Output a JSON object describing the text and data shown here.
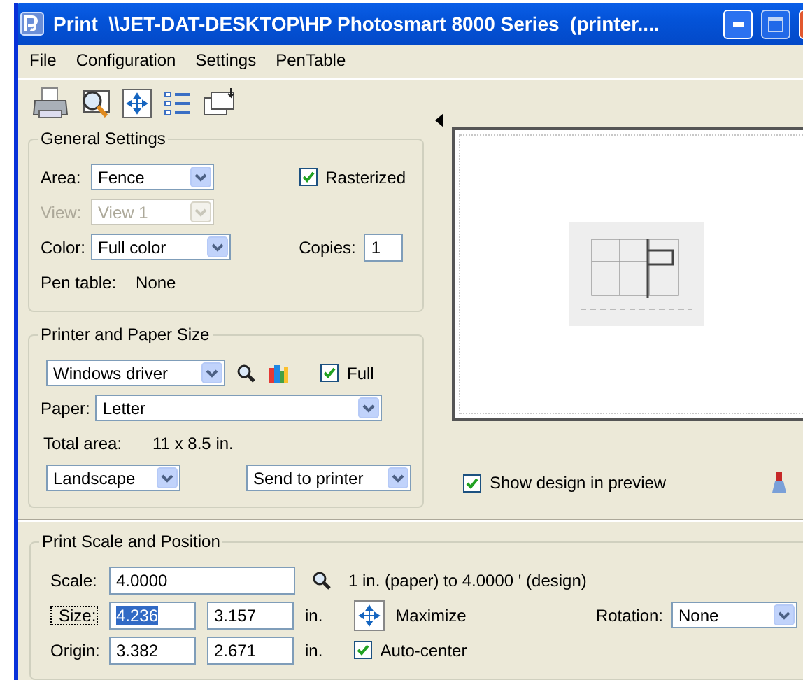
{
  "window": {
    "title": "Print  \\\\JET-DAT-DESKTOP\\HP Photosmart 8000 Series  (printer...."
  },
  "menu": [
    {
      "label": "File"
    },
    {
      "label": "Configuration"
    },
    {
      "label": "Settings"
    },
    {
      "label": "PenTable"
    }
  ],
  "general_settings": {
    "title": "General Settings",
    "area": {
      "label": "Area:",
      "value": "Fence",
      "disabled": false
    },
    "view": {
      "label": "View:",
      "value": "View 1",
      "disabled": true
    },
    "color": {
      "label": "Color:",
      "value": "Full color",
      "disabled": false
    },
    "rasterized": {
      "label": "Rasterized",
      "checked": true
    },
    "copies": {
      "label": "Copies:",
      "value": "1"
    },
    "pen_table": {
      "label": "Pen table:",
      "value": "None"
    }
  },
  "printer_and_paper": {
    "title": "Printer and Paper Size",
    "driver": {
      "value": "Windows driver"
    },
    "full": {
      "label": "Full",
      "checked": true
    },
    "paper": {
      "label": "Paper:",
      "value": "Letter"
    },
    "total_area": {
      "label": "Total area:",
      "value": "11 x 8.5 in."
    },
    "orientation": {
      "value": "Landscape"
    },
    "destination": {
      "value": "Send to printer"
    }
  },
  "preview": {
    "show_design": {
      "label": "Show design in preview",
      "checked": true
    }
  },
  "print_scale": {
    "title": "Print Scale and Position",
    "scale": {
      "label": "Scale:",
      "value": "4.0000",
      "description": "1 in. (paper) to 4.0000 ' (design)"
    },
    "size": {
      "label": "Size:",
      "width": {
        "value": "4.236",
        "selected": true
      },
      "height": {
        "value": "3.157",
        "selected": false
      },
      "unit": "in."
    },
    "maximize": {
      "label": "Maximize"
    },
    "rotation": {
      "label": "Rotation:",
      "value": "None"
    },
    "origin": {
      "label": "Origin:",
      "x": {
        "value": "3.382",
        "selected": false
      },
      "y": {
        "value": "2.671",
        "selected": false
      },
      "unit": "in."
    },
    "auto_center": {
      "label": "Auto-center",
      "checked": true
    }
  }
}
